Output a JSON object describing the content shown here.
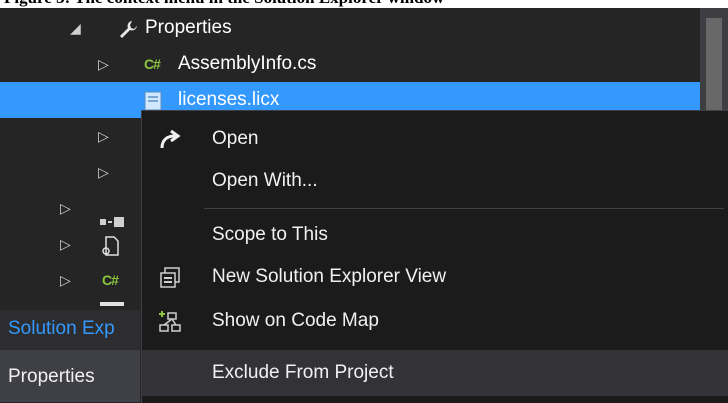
{
  "caption": {
    "text": "Figure 3: The context menu in the Solution Explorer window"
  },
  "tree": {
    "rows": [
      {
        "label": "Properties",
        "icon": "wrench-icon",
        "expanded": true
      },
      {
        "label": "AssemblyInfo.cs",
        "icon": "csharp-file-icon",
        "expanded": false
      },
      {
        "label": "licenses.licx",
        "icon": "licx-file-icon",
        "selected": true
      }
    ]
  },
  "tab": {
    "label": "Solution Exp"
  },
  "properties_pane": {
    "label": "Properties"
  },
  "context_menu": {
    "items": [
      {
        "label": "Open",
        "icon": "redo-arrow-icon"
      },
      {
        "label": "Open With..."
      },
      {
        "label": "Scope to This"
      },
      {
        "label": "New Solution Explorer View",
        "icon": "new-window-icon"
      },
      {
        "label": "Show on Code Map",
        "icon": "code-map-icon"
      },
      {
        "label": "Exclude From Project"
      }
    ]
  },
  "colors": {
    "selection": "#3399ff",
    "background": "#252526",
    "menu_background": "#1b1b1c",
    "csharp_icon": "#8dc63f"
  }
}
